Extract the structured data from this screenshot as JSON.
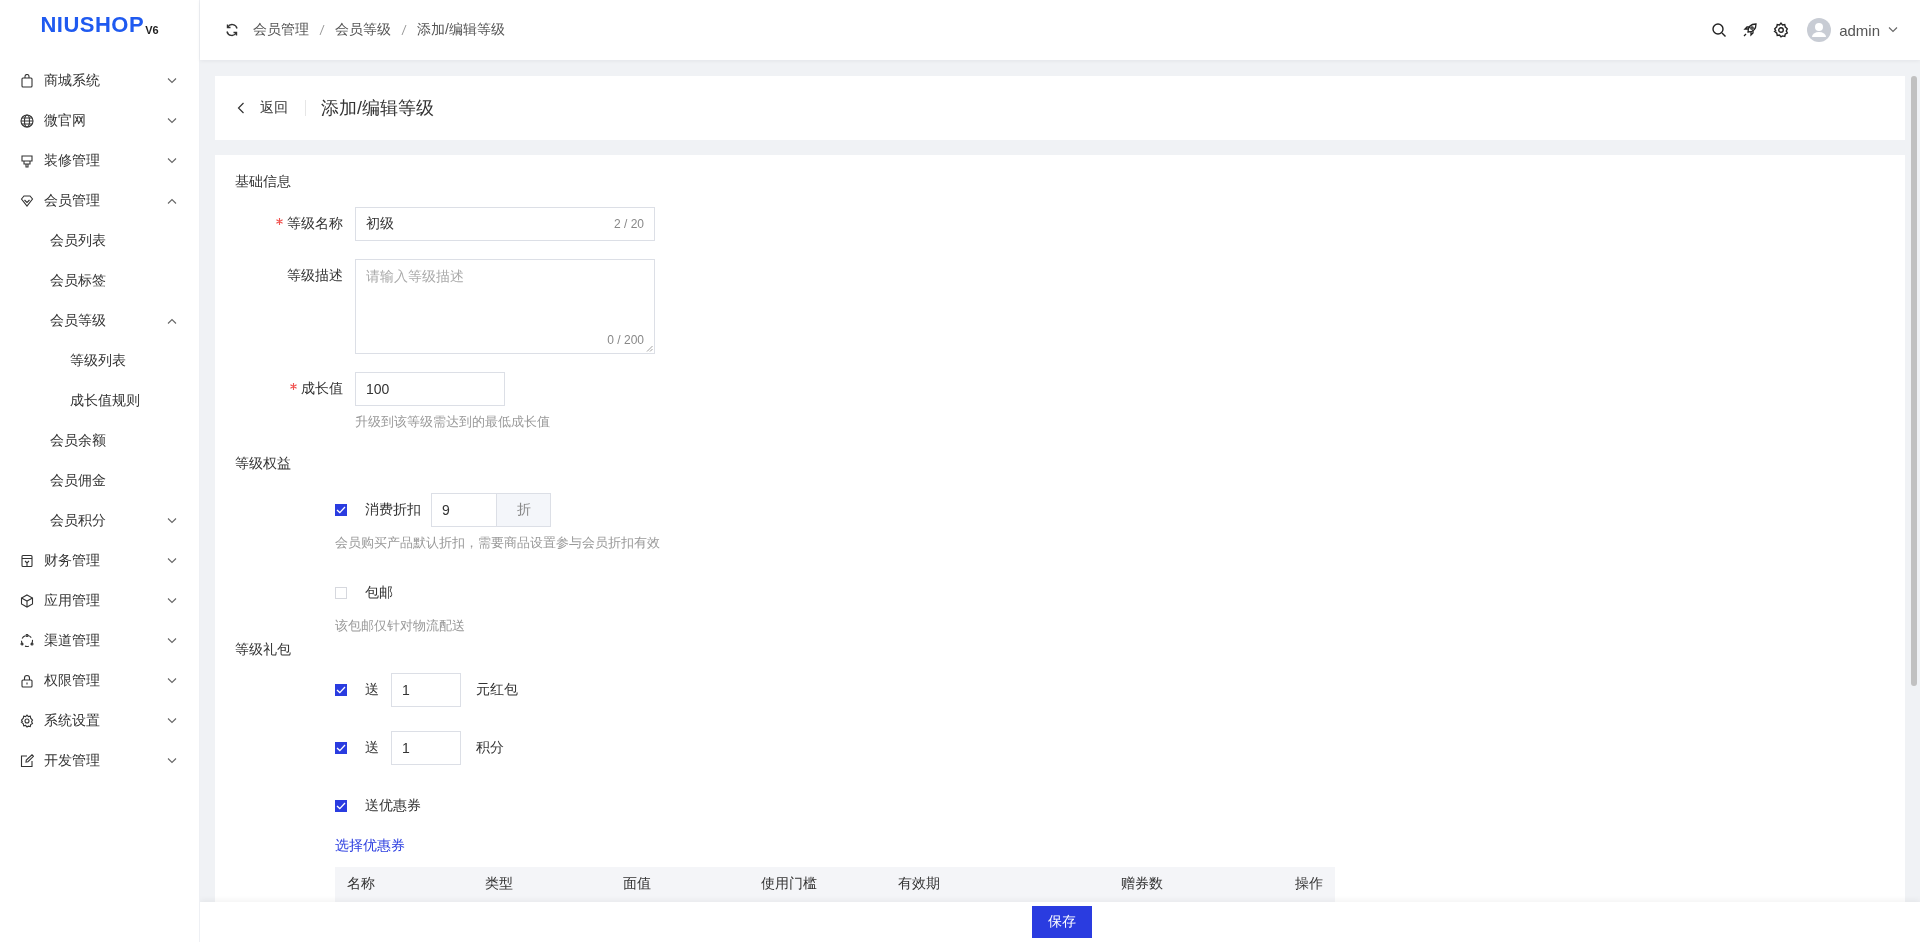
{
  "logo": {
    "name": "NIUSHOP",
    "version": "V6"
  },
  "sidebar": {
    "items": [
      {
        "label": "商城系统",
        "expanded": false
      },
      {
        "label": "微官网",
        "expanded": false
      },
      {
        "label": "装修管理",
        "expanded": false
      },
      {
        "label": "会员管理",
        "expanded": true,
        "children": [
          {
            "label": "会员列表"
          },
          {
            "label": "会员标签"
          },
          {
            "label": "会员等级",
            "expanded": true,
            "children": [
              {
                "label": "等级列表"
              },
              {
                "label": "成长值规则"
              }
            ]
          },
          {
            "label": "会员余额"
          },
          {
            "label": "会员佣金"
          },
          {
            "label": "会员积分",
            "expanded": false
          }
        ]
      },
      {
        "label": "财务管理",
        "expanded": false
      },
      {
        "label": "应用管理",
        "expanded": false
      },
      {
        "label": "渠道管理",
        "expanded": false
      },
      {
        "label": "权限管理",
        "expanded": false
      },
      {
        "label": "系统设置",
        "expanded": false
      },
      {
        "label": "开发管理",
        "expanded": false
      }
    ]
  },
  "topbar": {
    "breadcrumb": [
      "会员管理",
      "会员等级",
      "添加/编辑等级"
    ],
    "user": "admin"
  },
  "page_header": {
    "back": "返回",
    "title": "添加/编辑等级"
  },
  "basic": {
    "title": "基础信息",
    "fields": [
      {
        "kind": "text",
        "label": "等级名称",
        "required": true,
        "value": "初级",
        "counter": "2 / 20"
      },
      {
        "kind": "textarea",
        "label": "等级描述",
        "required": false,
        "placeholder": "请输入等级描述",
        "counter": "0 / 200"
      },
      {
        "kind": "number",
        "label": "成长值",
        "required": true,
        "value": "100",
        "hint": "升级到该等级需达到的最低成长值"
      }
    ]
  },
  "benefits": {
    "title": "等级权益",
    "items": [
      {
        "kind": "addon",
        "checked": true,
        "label": "消费折扣",
        "value": "9",
        "suffix": "折",
        "hint": "会员购买产品默认折扣，需要商品设置参与会员折扣有效"
      },
      {
        "kind": "plain",
        "checked": false,
        "label": "包邮",
        "hint": "该包邮仅针对物流配送"
      }
    ]
  },
  "gifts": {
    "title": "等级礼包",
    "items": [
      {
        "kind": "amount",
        "checked": true,
        "label": "送",
        "value": "1",
        "unit": "元红包"
      },
      {
        "kind": "amount",
        "checked": true,
        "label": "送",
        "value": "1",
        "unit": "积分"
      },
      {
        "kind": "plain",
        "checked": true,
        "label": "送优惠券"
      }
    ],
    "link": "选择优惠券",
    "table": {
      "columns": [
        "名称",
        "类型",
        "面值",
        "使用门槛",
        "有效期",
        "赠券数",
        "操作"
      ]
    }
  },
  "save_button": "保存"
}
